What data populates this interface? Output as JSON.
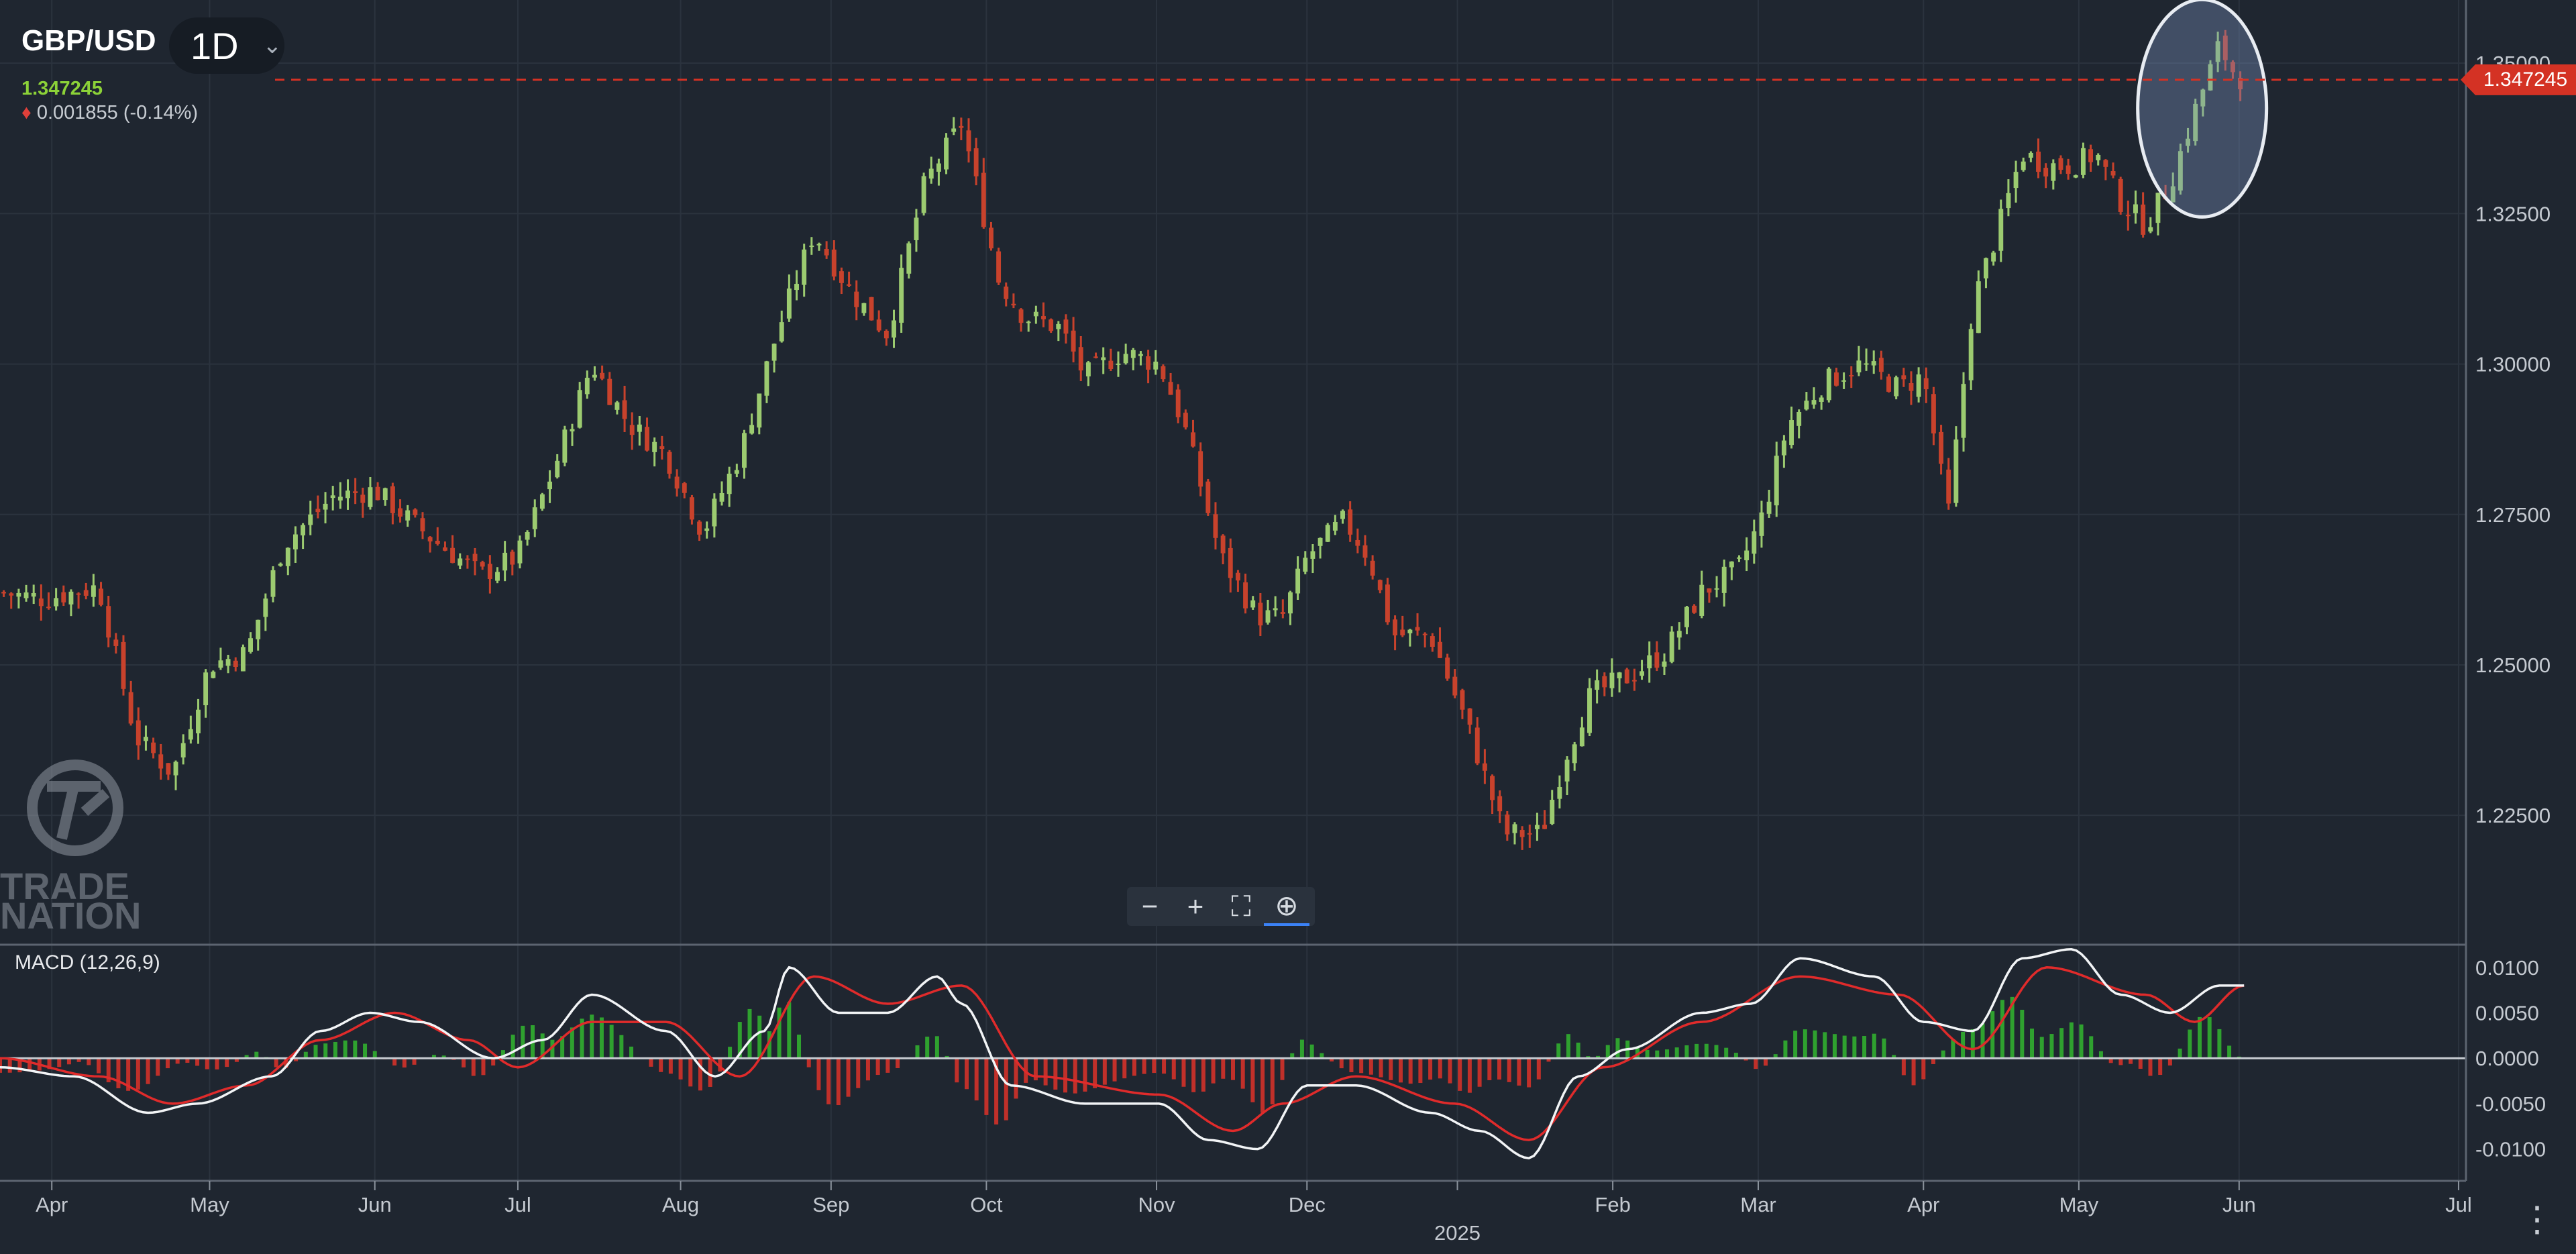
{
  "header": {
    "symbol": "GBP/USD",
    "timeframe": "1D",
    "last_price": "1.347245",
    "change": "0.001855 (-0.14%)",
    "price_color": "#8cd238",
    "down_color": "#e0403a"
  },
  "watermark": {
    "line1": "TRADE",
    "line2": "NATION"
  },
  "last_price_label": "1.347245",
  "macd_label": "MACD (12,26,9)",
  "colors": {
    "background": "#1f2630",
    "bull": "#9ccb70",
    "bear": "#c8422c",
    "macd": "#f2f4f6",
    "signal": "#e02b2b",
    "hist_pos": "#2fa12f",
    "hist_neg": "#c0302a",
    "price_line": "#d43224"
  },
  "zoom_controls": [
    "zoom-out",
    "zoom-in",
    "fullscreen",
    "zoom-reset"
  ],
  "chart_data": [
    {
      "type": "candlestick",
      "title": "GBP/USD 1D",
      "y_ticks": [
        "1.22500",
        "1.25000",
        "1.27500",
        "1.30000",
        "1.32500",
        "1.35000"
      ],
      "y_tick_values": [
        1.225,
        1.25,
        1.275,
        1.3,
        1.325,
        1.35
      ],
      "ylim": [
        1.2035,
        1.3605
      ],
      "x_ticks": [
        "Apr",
        "May",
        "Jun",
        "Jul",
        "Aug",
        "Sep",
        "Oct",
        "Nov",
        "Dec",
        "2025",
        "Feb",
        "Mar",
        "Apr",
        "May",
        "Jun",
        "Jul"
      ],
      "x_tick_positions": [
        0.021,
        0.085,
        0.152,
        0.21,
        0.276,
        0.337,
        0.4,
        0.469,
        0.53,
        0.591,
        0.654,
        0.713,
        0.78,
        0.843,
        0.908,
        0.997
      ],
      "approx_close_path": [
        [
          0.0,
          1.262
        ],
        [
          0.018,
          1.261
        ],
        [
          0.04,
          1.263
        ],
        [
          0.055,
          1.238
        ],
        [
          0.07,
          1.232
        ],
        [
          0.085,
          1.25
        ],
        [
          0.1,
          1.252
        ],
        [
          0.115,
          1.27
        ],
        [
          0.135,
          1.278
        ],
        [
          0.152,
          1.279
        ],
        [
          0.175,
          1.271
        ],
        [
          0.195,
          1.265
        ],
        [
          0.21,
          1.268
        ],
        [
          0.225,
          1.283
        ],
        [
          0.24,
          1.3
        ],
        [
          0.255,
          1.29
        ],
        [
          0.27,
          1.285
        ],
        [
          0.285,
          1.272
        ],
        [
          0.3,
          1.285
        ],
        [
          0.315,
          1.305
        ],
        [
          0.33,
          1.322
        ],
        [
          0.345,
          1.312
        ],
        [
          0.36,
          1.305
        ],
        [
          0.375,
          1.33
        ],
        [
          0.39,
          1.34
        ],
        [
          0.405,
          1.314
        ],
        [
          0.415,
          1.308
        ],
        [
          0.43,
          1.306
        ],
        [
          0.44,
          1.298
        ],
        [
          0.455,
          1.302
        ],
        [
          0.47,
          1.3
        ],
        [
          0.48,
          1.29
        ],
        [
          0.495,
          1.268
        ],
        [
          0.51,
          1.258
        ],
        [
          0.52,
          1.258
        ],
        [
          0.53,
          1.268
        ],
        [
          0.545,
          1.274
        ],
        [
          0.555,
          1.268
        ],
        [
          0.565,
          1.255
        ],
        [
          0.58,
          1.255
        ],
        [
          0.595,
          1.24
        ],
        [
          0.61,
          1.222
        ],
        [
          0.625,
          1.222
        ],
        [
          0.635,
          1.235
        ],
        [
          0.645,
          1.245
        ],
        [
          0.66,
          1.248
        ],
        [
          0.675,
          1.252
        ],
        [
          0.69,
          1.262
        ],
        [
          0.705,
          1.266
        ],
        [
          0.715,
          1.275
        ],
        [
          0.725,
          1.29
        ],
        [
          0.74,
          1.297
        ],
        [
          0.755,
          1.3
        ],
        [
          0.77,
          1.296
        ],
        [
          0.78,
          1.298
        ],
        [
          0.79,
          1.275
        ],
        [
          0.8,
          1.31
        ],
        [
          0.81,
          1.322
        ],
        [
          0.82,
          1.335
        ],
        [
          0.83,
          1.333
        ],
        [
          0.84,
          1.333
        ],
        [
          0.85,
          1.335
        ],
        [
          0.86,
          1.327
        ],
        [
          0.87,
          1.323
        ],
        [
          0.88,
          1.33
        ],
        [
          0.89,
          1.342
        ],
        [
          0.9,
          1.353
        ],
        [
          0.905,
          1.349
        ],
        [
          0.91,
          1.347
        ]
      ],
      "last": 1.347245,
      "horizontal_line": 1.347245,
      "highlight_ellipse_around": "last candles near 1.35"
    },
    {
      "type": "line",
      "title": "MACD (12,26,9)",
      "y_ticks": [
        "0.0100",
        "0.0050",
        "0.0000",
        "-0.0050",
        "-0.0100"
      ],
      "y_tick_values": [
        0.01,
        0.005,
        0.0,
        -0.005,
        -0.01
      ],
      "ylim": [
        -0.0135,
        0.0125
      ],
      "series": [
        {
          "name": "MACD",
          "points": [
            [
              0.0,
              -0.001
            ],
            [
              0.03,
              -0.002
            ],
            [
              0.06,
              -0.006
            ],
            [
              0.08,
              -0.005
            ],
            [
              0.11,
              -0.002
            ],
            [
              0.13,
              0.003
            ],
            [
              0.15,
              0.005
            ],
            [
              0.17,
              0.004
            ],
            [
              0.2,
              0.0
            ],
            [
              0.22,
              0.002
            ],
            [
              0.24,
              0.007
            ],
            [
              0.27,
              0.003
            ],
            [
              0.29,
              -0.002
            ],
            [
              0.31,
              0.003
            ],
            [
              0.32,
              0.01
            ],
            [
              0.34,
              0.005
            ],
            [
              0.36,
              0.005
            ],
            [
              0.38,
              0.009
            ],
            [
              0.39,
              0.006
            ],
            [
              0.41,
              -0.003
            ],
            [
              0.44,
              -0.005
            ],
            [
              0.47,
              -0.005
            ],
            [
              0.49,
              -0.009
            ],
            [
              0.51,
              -0.01
            ],
            [
              0.53,
              -0.003
            ],
            [
              0.55,
              -0.003
            ],
            [
              0.58,
              -0.006
            ],
            [
              0.6,
              -0.008
            ],
            [
              0.62,
              -0.011
            ],
            [
              0.64,
              -0.002
            ],
            [
              0.66,
              0.001
            ],
            [
              0.69,
              0.005
            ],
            [
              0.71,
              0.006
            ],
            [
              0.73,
              0.011
            ],
            [
              0.76,
              0.009
            ],
            [
              0.78,
              0.004
            ],
            [
              0.8,
              0.003
            ],
            [
              0.82,
              0.011
            ],
            [
              0.84,
              0.012
            ],
            [
              0.86,
              0.007
            ],
            [
              0.88,
              0.005
            ],
            [
              0.9,
              0.008
            ],
            [
              0.91,
              0.008
            ]
          ]
        },
        {
          "name": "Signal",
          "points": [
            [
              0.0,
              0.0
            ],
            [
              0.04,
              -0.002
            ],
            [
              0.07,
              -0.005
            ],
            [
              0.1,
              -0.003
            ],
            [
              0.13,
              0.002
            ],
            [
              0.16,
              0.005
            ],
            [
              0.19,
              0.002
            ],
            [
              0.21,
              -0.001
            ],
            [
              0.24,
              0.004
            ],
            [
              0.27,
              0.004
            ],
            [
              0.3,
              -0.002
            ],
            [
              0.33,
              0.009
            ],
            [
              0.36,
              0.006
            ],
            [
              0.39,
              0.008
            ],
            [
              0.42,
              -0.002
            ],
            [
              0.47,
              -0.004
            ],
            [
              0.5,
              -0.008
            ],
            [
              0.52,
              -0.005
            ],
            [
              0.55,
              -0.002
            ],
            [
              0.59,
              -0.005
            ],
            [
              0.62,
              -0.009
            ],
            [
              0.65,
              -0.001
            ],
            [
              0.69,
              0.004
            ],
            [
              0.73,
              0.009
            ],
            [
              0.77,
              0.007
            ],
            [
              0.8,
              0.001
            ],
            [
              0.83,
              0.01
            ],
            [
              0.87,
              0.007
            ],
            [
              0.89,
              0.004
            ],
            [
              0.91,
              0.008
            ]
          ]
        }
      ],
      "histogram": "MACD minus Signal"
    }
  ]
}
